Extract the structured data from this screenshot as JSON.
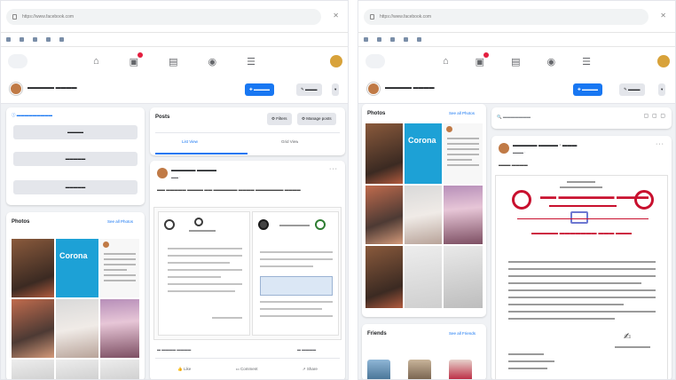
{
  "browser": {
    "url": "https://www.facebook.com",
    "bookmarks": [
      "",
      "",
      "",
      "",
      "",
      ""
    ]
  },
  "left": {
    "page_actions": {
      "primary": "",
      "secondary": ""
    },
    "sidebar": {
      "intro_link": "",
      "buttons": [
        "",
        "",
        ""
      ]
    },
    "photos": {
      "title": "Photos",
      "see_all": "See all Photos",
      "tile_text": "Corona"
    },
    "posts": {
      "title": "Posts",
      "filters": "Filters",
      "manage": "Manage posts",
      "tab_list": "List View",
      "tab_grid": "Grid View"
    },
    "post": {
      "author": "",
      "meta": "",
      "text": "",
      "reactions": "",
      "comments": "",
      "like": "Like",
      "comment": "Comment",
      "share": "Share"
    }
  },
  "right": {
    "page_actions": {
      "primary": "",
      "secondary": ""
    },
    "photos": {
      "title": "Photos",
      "see_all": "See all Photos"
    },
    "friends": {
      "title": "Friends",
      "see_all": "See all Friends"
    },
    "search_placeholder": "",
    "post": {
      "author": "",
      "meta": "",
      "text": ""
    }
  },
  "colors": {
    "accent": "#1877f2",
    "bg": "#f0f2f5",
    "seal_red": "#c8102e"
  },
  "icons": [
    "home-icon",
    "video-icon",
    "marketplace-icon",
    "groups-icon",
    "menu-icon"
  ]
}
